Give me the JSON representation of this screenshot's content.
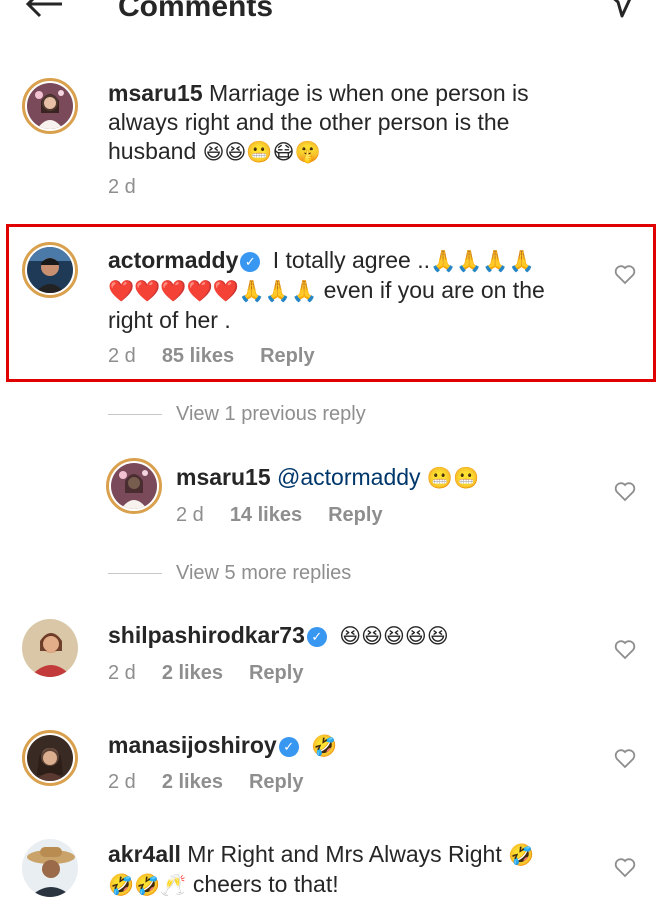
{
  "header": {
    "title": "Comments"
  },
  "comments": [
    {
      "user": "msaru15",
      "text_line1": "Marriage is when one person is",
      "text_line2": "always right and the other person is the",
      "text_line3": "husband",
      "emojis": "😆😆😬😷🤫",
      "time": "2 d"
    },
    {
      "user": "actormaddy",
      "verified": true,
      "text_part1": "I totally agree ..",
      "emojis1": "🙏🙏🙏🙏",
      "emojis2": "❤️❤️❤️❤️❤️🙏🙏🙏",
      "text_part2": "even if you are on the",
      "text_part3": "right of her .",
      "time": "2 d",
      "likes": "85 likes",
      "reply": "Reply"
    }
  ],
  "view_previous": "View 1 previous reply",
  "reply_comment": {
    "user": "msaru15",
    "mention": "@actormaddy",
    "emojis": "😬😬",
    "time": "2 d",
    "likes": "14 likes",
    "reply": "Reply"
  },
  "view_more": "View 5 more replies",
  "comments2": [
    {
      "user": "shilpashirodkar73",
      "verified": true,
      "emojis": "😆😆😆😆😆",
      "time": "2 d",
      "likes": "2 likes",
      "reply": "Reply"
    },
    {
      "user": "manasijoshiroy",
      "verified": true,
      "emojis": "🤣",
      "time": "2 d",
      "likes": "2 likes",
      "reply": "Reply"
    },
    {
      "user": "akr4all",
      "text_part1": "Mr Right and Mrs Always Right",
      "emoji1": "🤣",
      "emojis2": "🤣🤣🥂",
      "text_part2": "cheers to that!"
    }
  ]
}
